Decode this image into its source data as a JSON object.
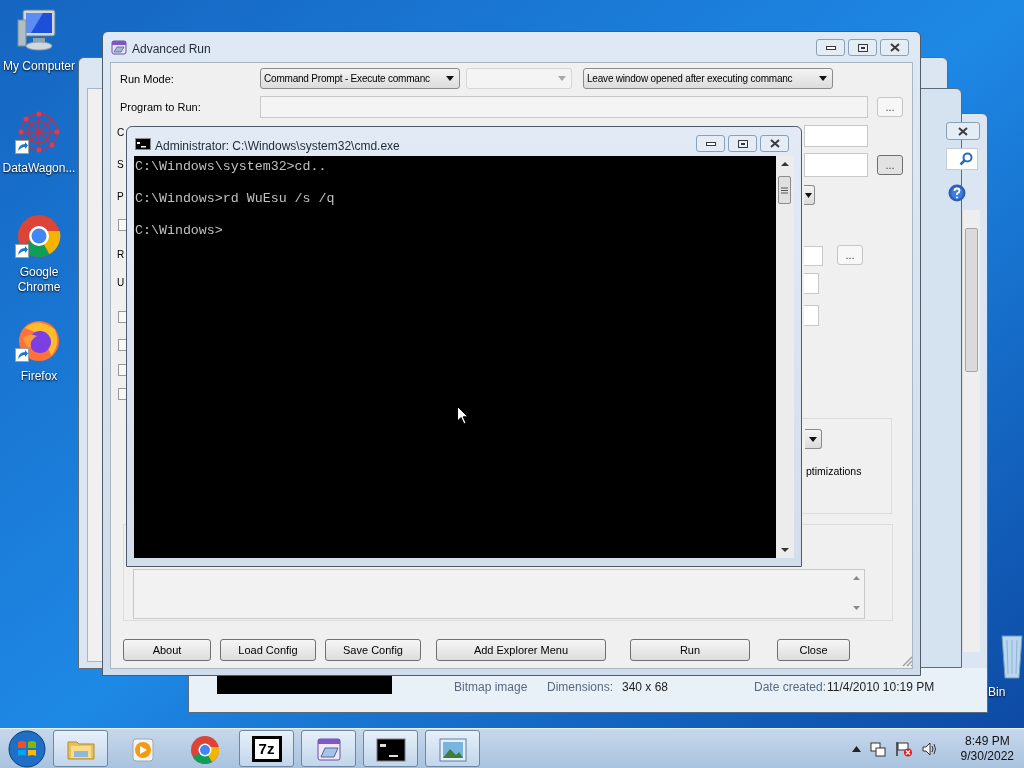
{
  "desktop_icons": [
    {
      "kind": "computer",
      "label": "My Computer",
      "shortcut": false
    },
    {
      "kind": "network",
      "label": "DataWagon...",
      "shortcut": true
    },
    {
      "kind": "chrome",
      "label": "Google Chrome",
      "shortcut": true
    },
    {
      "kind": "firefox",
      "label": "Firefox",
      "shortcut": true
    }
  ],
  "recycle_bin": {
    "label": "Bin"
  },
  "explorer_window": {
    "file_type": "Bitmap image",
    "dimensions_label": "Dimensions:",
    "dimensions": "340 x 68",
    "date_label": "Date created:",
    "date": "11/4/2010 10:19 PM"
  },
  "advanced_run": {
    "title": "Advanced Run",
    "run_mode_label": "Run Mode:",
    "run_mode": "Command Prompt - Execute commanc",
    "window_option": "Leave window opened after executing commanc",
    "program_label": "Program to Run:",
    "cut_labels": [
      "C",
      "S",
      "P",
      "R",
      "U"
    ],
    "browse_buttons": [
      "...",
      "...",
      "..."
    ],
    "checkboxes": [
      {
        "checked": false
      },
      {
        "checked": false
      },
      {
        "checked": false
      },
      {
        "checked": false
      },
      {
        "checked": false
      }
    ],
    "options_text": "ptimizations",
    "buttons": [
      "About",
      "Load Config",
      "Save Config",
      "Add Explorer Menu",
      "Run",
      "Close"
    ]
  },
  "cmd": {
    "title": "Administrator: C:\\Windows\\system32\\cmd.exe",
    "lines": [
      "C:\\Windows\\system32>cd..",
      "C:\\Windows>rd WuEsu /s /q",
      "C:\\Windows>"
    ]
  },
  "taskbar": {
    "items": [
      {
        "kind": "folder",
        "open": true
      },
      {
        "kind": "media",
        "open": false
      },
      {
        "kind": "chrome",
        "open": false
      },
      {
        "kind": "sevenzip",
        "open": true,
        "label": "7z"
      },
      {
        "kind": "advrun",
        "open": true
      },
      {
        "kind": "console",
        "open": true
      },
      {
        "kind": "photo",
        "open": true
      }
    ],
    "time": "8:49 PM",
    "date": "9/30/2022"
  }
}
